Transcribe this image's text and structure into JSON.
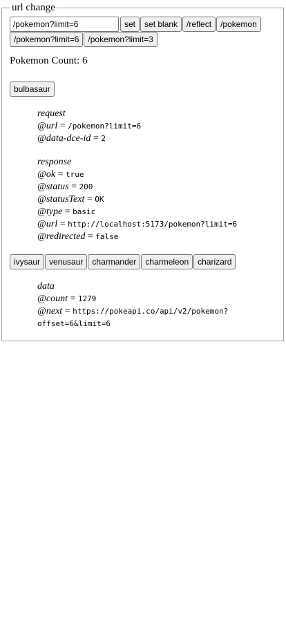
{
  "legend": "url change",
  "url_input": {
    "value": "/pokemon?limit=6"
  },
  "buttons": {
    "set": "set",
    "set_blank": "set blank",
    "reflect": "/reflect",
    "pokemon": "/pokemon",
    "pokemon_limit6": "/pokemon?limit=6",
    "pokemon_limit3": "/pokemon?limit=3"
  },
  "pokemon_count": "Pokemon Count: 6",
  "first_pokemon": "bulbasaur",
  "request": {
    "title": "request",
    "url_key": "@url",
    "url_val": "/pokemon?limit=6",
    "dceid_key": "@data-dce-id",
    "dceid_val": "2"
  },
  "response": {
    "title": "response",
    "ok_key": "@ok",
    "ok_val": "true",
    "status_key": "@status",
    "status_val": "200",
    "statustext_key": "@statusText",
    "statustext_val": "OK",
    "type_key": "@type",
    "type_val": "basic",
    "url_key": "@url",
    "url_val": "http://localhost:5173/pokemon?limit=6",
    "redirected_key": "@redirected",
    "redirected_val": "false"
  },
  "pokemon_buttons": [
    "ivysaur",
    "venusaur",
    "charmander",
    "charmeleon",
    "charizard"
  ],
  "data": {
    "title": "data",
    "count_key": "@count",
    "count_val": "1279",
    "next_key": "@next",
    "next_val_line1": "https://pokeapi.co/api/v2/pokemon?",
    "next_val_line2": "offset=6&limit=6"
  },
  "eq": "="
}
